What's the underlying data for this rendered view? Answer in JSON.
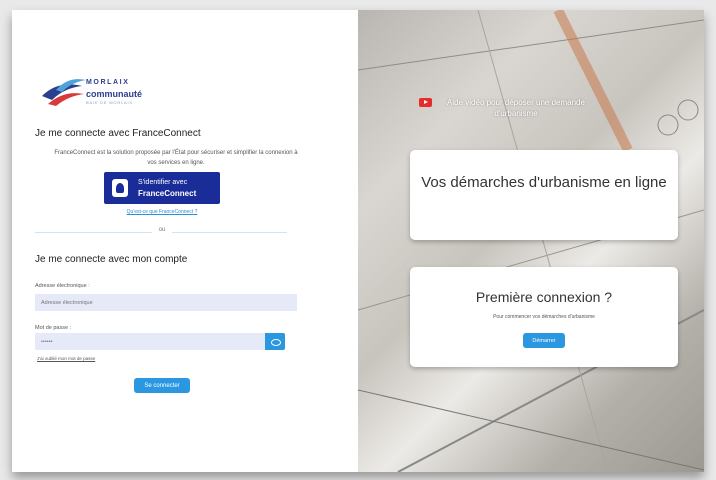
{
  "logo": {
    "brand_top": "MORLAIX",
    "brand_name": "communauté",
    "brand_tagline": "BAIE DE MORLAIX"
  },
  "franceconnect": {
    "title": "Je me connecte avec FranceConnect",
    "description": "FranceConnect est la solution proposée par l'État pour sécuriser et simplifier la connexion à vos services en ligne.",
    "button_line1": "S'identifier avec",
    "button_line2": "FranceConnect",
    "link": "Qu'est-ce que FranceConnect ?"
  },
  "separator": "ou",
  "account": {
    "title": "Je me connecte avec mon compte",
    "email_label": "Adresse électronique :",
    "email_placeholder": "Adresse électronique",
    "password_label": "Mot de passe :",
    "password_value": "••••••",
    "forgot_link": "J'ai oublié mon mot de passe",
    "login_button": "Se connecter"
  },
  "right": {
    "video_text": "Aide vidéo pour déposer une demande d'urbanisme",
    "card1_title": "Vos démarches d'urbanisme en ligne",
    "card2_title": "Première connexion ?",
    "card2_subtitle": "Pour commencer vos démarches d'urbanisme",
    "card2_button": "Démarrer"
  },
  "colors": {
    "accent": "#2a97e0",
    "franceconnect": "#1a2c98",
    "youtube": "#e52b2b"
  }
}
